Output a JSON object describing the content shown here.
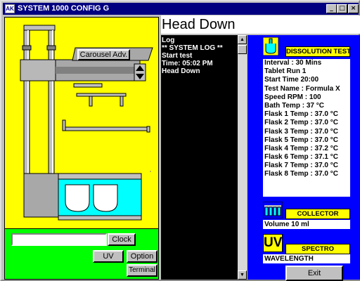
{
  "window": {
    "title": "SYSTEM 1000 CONFIG G",
    "app_icon_text": "AK",
    "minimize_glyph": "_",
    "maximize_glyph": "□",
    "close_glyph": "×"
  },
  "machine": {
    "carousel_button": "Carousel Adv."
  },
  "controls": {
    "clock_field_value": "",
    "clock_button": "Clock",
    "uv_button": "UV",
    "option_button": "Option",
    "terminal_button": "Terminal"
  },
  "status_title": "Head Down",
  "log": {
    "lines": [
      "Log",
      "** SYSTEM LOG **",
      "Start test",
      "Time: 05:02 PM",
      "Head Down"
    ]
  },
  "dissolution": {
    "label": "DISSOLUTION TEST",
    "lines": [
      "Interval : 30 Mins",
      "Tablet Run 1",
      "Start Time  20:00",
      "Test Name : Formula X",
      "Speed RPM  : 100",
      "Bath Temp  : 37 °C",
      "Flask 1 Temp  : 37.0 °C",
      "Flask 2 Temp  : 37.0 °C",
      "Flask 3 Temp  : 37.0 °C",
      "Flask 5 Temp  : 37.0 °C",
      "Flask 4 Temp  : 37.2 °C",
      "Flask 6 Temp  : 37.1 °C",
      "Flask 7 Temp  : 37.0 °C",
      "Flask 8 Temp  : 37.0 °C"
    ]
  },
  "collector": {
    "label": "COLLECTOR",
    "volume": "Volume 10 ml"
  },
  "spectro": {
    "icon_text": "UV",
    "label": "SPECTRO",
    "wavelength": "WAVELENGTH"
  },
  "exit_button": "Exit",
  "colors": {
    "titlebar": "#000080",
    "machine_bg": "#ffff00",
    "controls_bg": "#00ff00",
    "panel_blue": "#0000ff",
    "bath_cyan": "#00ffff"
  }
}
